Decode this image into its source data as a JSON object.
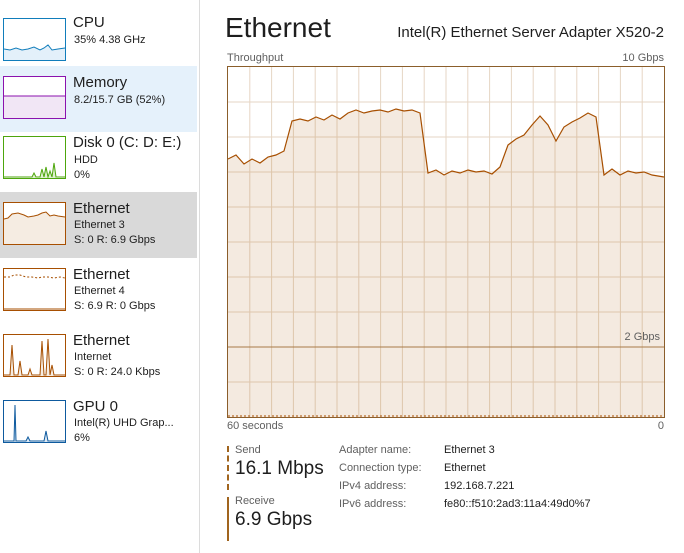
{
  "sidebar": {
    "items": [
      {
        "title": "CPU",
        "sub1": "35%  4.38 GHz",
        "sub2": ""
      },
      {
        "title": "Memory",
        "sub1": "8.2/15.7 GB (52%)",
        "sub2": ""
      },
      {
        "title": "Disk 0 (C: D: E:)",
        "sub1": "HDD",
        "sub2": "0%"
      },
      {
        "title": "Ethernet",
        "sub1": "Ethernet 3",
        "sub2": "S: 0  R: 6.9 Gbps"
      },
      {
        "title": "Ethernet",
        "sub1": "Ethernet 4",
        "sub2": "S: 6.9  R: 0 Gbps"
      },
      {
        "title": "Ethernet",
        "sub1": "Internet",
        "sub2": "S: 0  R: 24.0 Kbps"
      },
      {
        "title": "GPU 0",
        "sub1": "Intel(R) UHD Grap...",
        "sub2": "6%"
      }
    ]
  },
  "main": {
    "title": "Ethernet",
    "adapter": "Intel(R) Ethernet Server Adapter X520-2",
    "graph": {
      "label": "Throughput",
      "max": "10 Gbps",
      "mid": "2 Gbps",
      "time": "60 seconds",
      "zero": "0"
    },
    "send": {
      "label": "Send",
      "value": "16.1 Mbps"
    },
    "receive": {
      "label": "Receive",
      "value": "6.9 Gbps"
    },
    "info": [
      {
        "key": "Adapter name:",
        "value": "Ethernet 3"
      },
      {
        "key": "Connection type:",
        "value": "Ethernet"
      },
      {
        "key": "IPv4 address:",
        "value": "192.168.7.221"
      },
      {
        "key": "IPv6 address:",
        "value": "fe80::f510:2ad3:11a4:49d0%7"
      }
    ]
  },
  "colors": {
    "cpu": "#117dbb",
    "memory": "#8b12ae",
    "disk": "#4da60c",
    "ethernet": "#a74f01",
    "gpu": "#0e5a9e",
    "selected": "#d9d9d9"
  }
}
